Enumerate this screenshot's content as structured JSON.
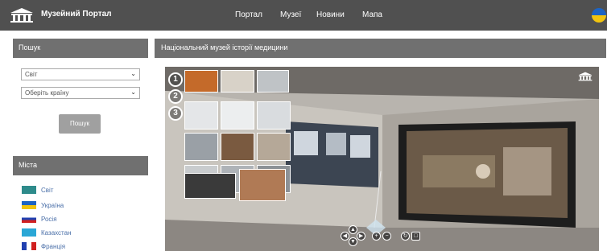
{
  "header": {
    "brand": "Музейний Портал",
    "nav": [
      "Портал",
      "Музеї",
      "Новини",
      "Мапа"
    ]
  },
  "sidebar": {
    "search_title": "Пошук",
    "region_select": "Світ",
    "country_select": "Оберіть країну",
    "search_button": "Пошук",
    "cities_title": "Міста",
    "cities": [
      "Світ",
      "Україна",
      "Росія",
      "Казахстан",
      "Франція"
    ]
  },
  "main": {
    "title": "Національний музей історії медицини",
    "tour_numbers": [
      "1",
      "2",
      "3"
    ],
    "logo_icon": "museum-columns-icon"
  },
  "colors": {
    "topbar": "#505050",
    "panel_header": "#707070",
    "link": "#4a6fa8"
  }
}
